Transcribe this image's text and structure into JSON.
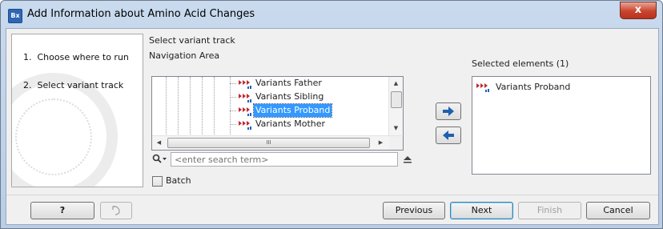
{
  "window": {
    "title": "Add Information about Amino Acid Changes",
    "app_icon_text": "Bx",
    "close_label": "x"
  },
  "steps": [
    {
      "number": "1.",
      "label": "Choose where to run"
    },
    {
      "number": "2.",
      "label": "Select variant track"
    }
  ],
  "panel": {
    "heading": "Select variant track",
    "navigation_label": "Navigation Area",
    "selected_label": "Selected elements (1)"
  },
  "tree": {
    "items": [
      {
        "label": "Variants Father",
        "selected": false
      },
      {
        "label": "Variants Sibling",
        "selected": false
      },
      {
        "label": "Variants Proband",
        "selected": true
      },
      {
        "label": "Variants Mother",
        "selected": false
      }
    ],
    "hscroll_grip": "III"
  },
  "search": {
    "placeholder": "<enter search term>"
  },
  "batch": {
    "label": "Batch",
    "checked": false
  },
  "selected_elements": [
    {
      "label": "Variants Proband"
    }
  ],
  "footer": {
    "help_label": "?",
    "previous_label": "Previous",
    "next_label": "Next",
    "finish_label": "Finish",
    "cancel_label": "Cancel"
  },
  "icons": {
    "variant_track": "variant-track-icon",
    "search": "search-icon",
    "add": "arrow-right-icon",
    "remove": "arrow-left-icon",
    "reset": "reset-icon",
    "collapse": "collapse-icon"
  },
  "colors": {
    "selection": "#3399ff",
    "arrow_blue": "#1f5fae",
    "variant_red": "#c0282d",
    "variant_blue": "#2060c0"
  }
}
